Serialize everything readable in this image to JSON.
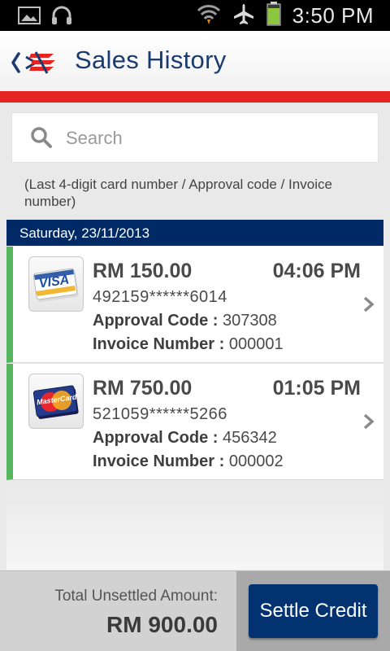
{
  "status_bar": {
    "time": "3:50 PM",
    "icons": [
      "gallery-icon",
      "headphones-icon",
      "wifi-icon",
      "airplane-icon",
      "battery-icon"
    ]
  },
  "header": {
    "title": "Sales History",
    "accent_color": "#e52521",
    "title_color": "#1a3a70"
  },
  "search": {
    "placeholder": "Search",
    "value": "",
    "hint": "(Last 4-digit card number / Approval code / Invoice number)"
  },
  "date_group": {
    "label": "Saturday, 23/11/2013"
  },
  "transactions": [
    {
      "card_brand": "VISA",
      "amount": "RM 150.00",
      "time": "04:06 PM",
      "card_number": "492159******6014",
      "approval_label": "Approval Code :",
      "approval_code": "307308",
      "invoice_label": "Invoice Number :",
      "invoice_number": "000001"
    },
    {
      "card_brand": "MasterCard",
      "amount": "RM 750.00",
      "time": "01:05 PM",
      "card_number": "521059******5266",
      "approval_label": "Approval Code :",
      "approval_code": "456342",
      "invoice_label": "Invoice Number :",
      "invoice_number": "000002"
    }
  ],
  "footer": {
    "total_label": "Total Unsettled Amount:",
    "total_value": "RM 900.00",
    "settle_button": "Settle Credit"
  }
}
